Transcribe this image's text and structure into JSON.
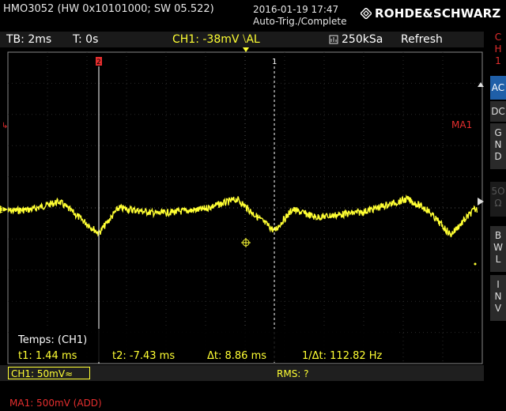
{
  "header": {
    "model": "HMO3052 (HW 0x10101000; SW 05.522)",
    "date": "2016-01-19 17:47",
    "status": "Auto-Trig./Complete",
    "brand": "ROHDE&SCHWARZ"
  },
  "infobar": {
    "timebase": "TB: 2ms",
    "trigger_time": "T: 0s",
    "ch1_trigger": "CH1: -38mV ⧵AL",
    "sample_rate": "250kSa",
    "mode": "Refresh"
  },
  "sidebar": {
    "channel": [
      "C",
      "H",
      "1"
    ],
    "ac": "AC",
    "dc": "DC",
    "gnd": [
      "G",
      "N",
      "D"
    ],
    "ohm50": [
      "5O",
      "Ω"
    ],
    "bwl": [
      "B",
      "W",
      "L"
    ],
    "inv": [
      "I",
      "N",
      "V"
    ]
  },
  "screen": {
    "ma1_label": "MA1",
    "cursor2_label": "2",
    "cursor1_label": "1",
    "ch_marker": "1",
    "measure_title": "Temps: (CH1)",
    "t1": "t1: 1.44 ms",
    "t2": "t2: -7.43 ms",
    "dt": "Δt: 8.86 ms",
    "inv_dt": "1/Δt: 112.82 Hz"
  },
  "bottom": {
    "ch1_scale": "CH1: 50mV≈",
    "rms": "RMS: ?",
    "ma1": "MA1: 500mV (ADD)"
  },
  "colors": {
    "trace": "#ffff33",
    "accent_red": "#e52e2e",
    "selected_blue": "#1f5fa8"
  }
}
